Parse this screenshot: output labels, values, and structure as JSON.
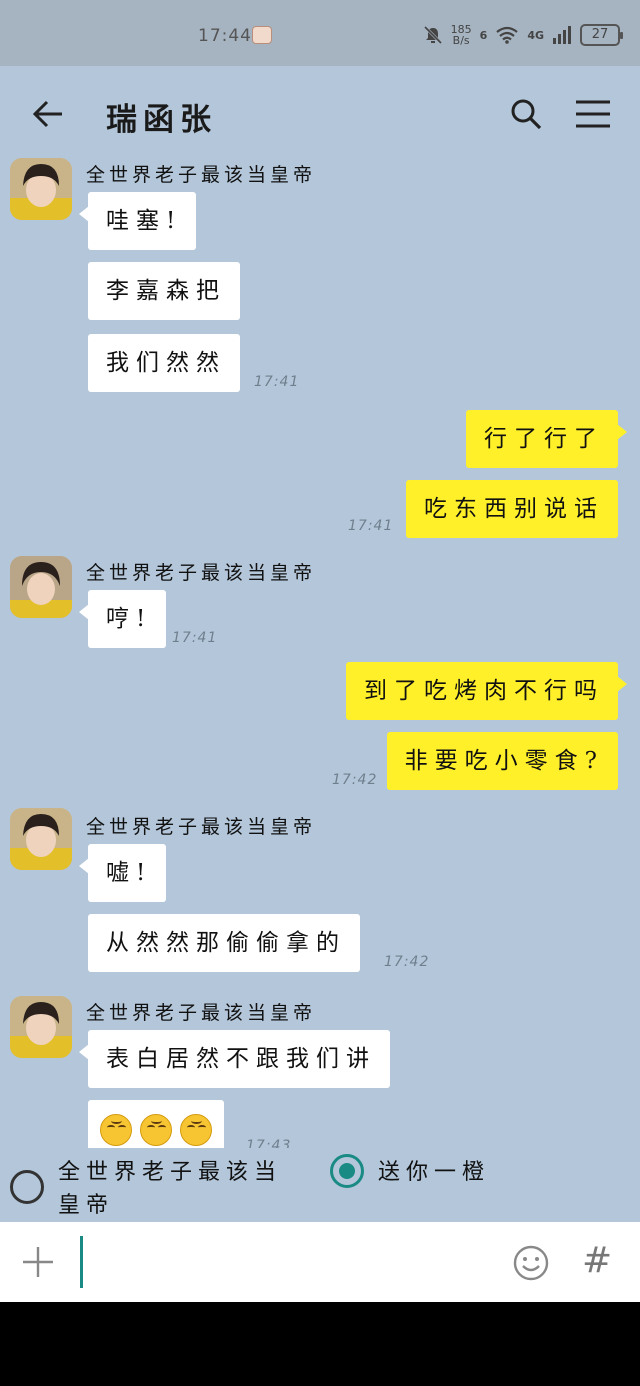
{
  "status_bar": {
    "time": "17:44",
    "net_speed_value": "185",
    "net_speed_unit": "B/s",
    "network_label": "4G",
    "signal_bars_label": "6",
    "battery": "27"
  },
  "header": {
    "title": "瑞函张"
  },
  "messages": [
    {
      "sender": "全世界老子最该当皇帝"
    },
    {
      "text": "哇塞!"
    },
    {
      "text": "李嘉森把"
    },
    {
      "text": "我们然然",
      "time": "17:41"
    },
    {
      "text": "行了行了"
    },
    {
      "text": "吃东西别说话",
      "time": "17:41"
    },
    {
      "sender": "全世界老子最该当皇帝"
    },
    {
      "text": "哼!",
      "time": "17:41"
    },
    {
      "text": "到了吃烤肉不行吗"
    },
    {
      "text": "非要吃小零食?",
      "time": "17:42"
    },
    {
      "sender": "全世界老子最该当皇帝"
    },
    {
      "text": "嘘!"
    },
    {
      "text": "从然然那偷偷拿的",
      "time": "17:42"
    },
    {
      "sender": "全世界老子最该当皇帝"
    },
    {
      "text": "表白居然不跟我们讲"
    },
    {
      "emojis": [
        "upside-down-face",
        "upside-down-face",
        "upside-down-face"
      ],
      "time": "17:43"
    }
  ],
  "choices": [
    {
      "label_line1": "全世界老子最该当",
      "label_line2": "皇帝",
      "selected": false
    },
    {
      "label_line1": "送你一橙",
      "selected": true
    }
  ],
  "colors": {
    "chat_background": "#b4c7da",
    "outgoing_bubble": "#fff02a",
    "incoming_bubble": "#ffffff",
    "accent": "#1a8b84"
  },
  "icons": {
    "back": "arrow-left-icon",
    "search": "search-icon",
    "menu": "hamburger-menu-icon",
    "plus": "plus-icon",
    "emoji": "smiley-icon",
    "hash": "hash-icon"
  },
  "input_bar": {
    "hash_glyph": "#"
  }
}
